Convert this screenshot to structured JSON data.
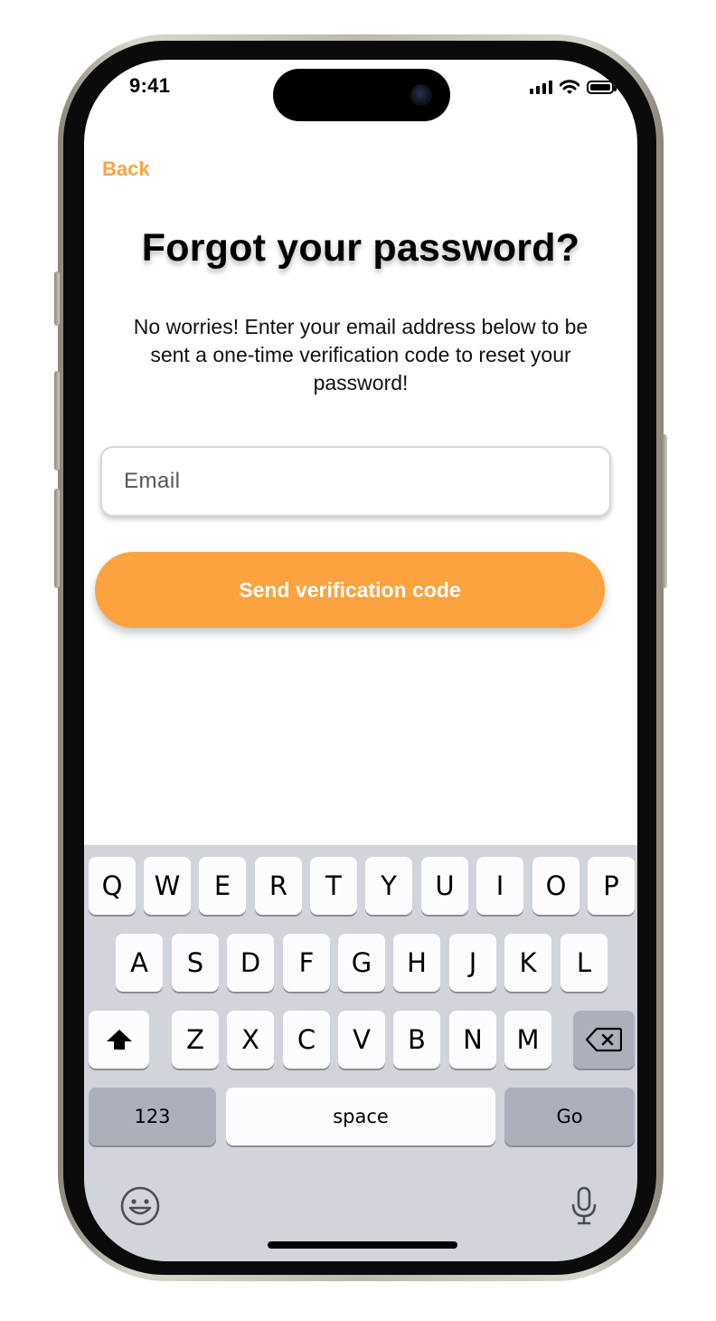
{
  "status_bar": {
    "time": "9:41"
  },
  "header": {
    "back_label": "Back"
  },
  "main": {
    "title": "Forgot your password?",
    "subtitle": "No worries! Enter your email address below to be sent a one-time verification code to reset your password!",
    "email": {
      "placeholder": "Email",
      "value": ""
    },
    "send_button_label": "Send verification code"
  },
  "keyboard": {
    "row1": [
      "Q",
      "W",
      "E",
      "R",
      "T",
      "Y",
      "U",
      "I",
      "O",
      "P"
    ],
    "row2": [
      "A",
      "S",
      "D",
      "F",
      "G",
      "H",
      "J",
      "K",
      "L"
    ],
    "row3": [
      "Z",
      "X",
      "C",
      "V",
      "B",
      "N",
      "M"
    ],
    "numbers_label": "123",
    "space_label": "space",
    "go_label": "Go",
    "icons": [
      "shift-icon",
      "backspace-icon",
      "emoji-icon",
      "microphone-icon"
    ]
  },
  "colors": {
    "accent": "#fca33f",
    "keyboard_bg": "#d1d4db",
    "key_bg": "#fcfcfe",
    "key_dark_bg": "#abb0bb"
  }
}
